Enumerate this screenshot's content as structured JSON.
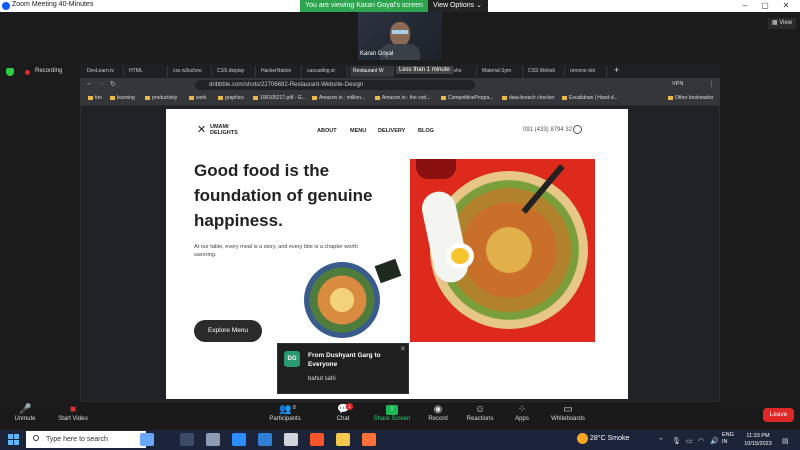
{
  "zoom": {
    "window_title": "Zoom Meeting 40-Minutes",
    "share_banner": "You are viewing Karan Goyal's screen",
    "view_options": "View Options",
    "view_button": "View",
    "recording_label": "Recording",
    "participant_name": "Karan Goyal",
    "overlay_text": "Less than 1 minute",
    "toolbar": {
      "unmute": "Unmute",
      "start_video": "Start Video",
      "participants": "Participants",
      "participants_count": "8",
      "chat": "Chat",
      "chat_badge": "1",
      "share_screen": "Share Screen",
      "record": "Record",
      "reactions": "Reactions",
      "apps": "Apps",
      "whiteboards": "Whiteboards",
      "leave": "Leave"
    },
    "chat_toast": {
      "avatar_initials": "DG",
      "title": "From Dushyant Garg to Everyone",
      "message": "bahut sahi"
    }
  },
  "browser": {
    "tabs": [
      {
        "label": "DevLearn.tv"
      },
      {
        "label": "HTML"
      },
      {
        "label": "css w3schoo"
      },
      {
        "label": "CSS display"
      },
      {
        "label": "HackerNation"
      },
      {
        "label": "cascading st"
      },
      {
        "label": "Restaurant W"
      },
      {
        "label": "in code sho"
      },
      {
        "label": "Material Sym"
      },
      {
        "label": "CSS Websit"
      },
      {
        "label": "remove dot"
      }
    ],
    "url": "dribbble.com/shots/22706692-Restaurant-Website-Design",
    "vpn": "VPN",
    "bookmarks": [
      "fun",
      "learning",
      "productivity",
      "work",
      "graphics",
      "106105217.pdf - G...",
      "Amazon.in : million...",
      "Amazon.in : the cod...",
      "CompetitiveProgra...",
      "data-breach checker",
      "Excalidraw | Hand-d...",
      "Other bookmarks"
    ]
  },
  "site": {
    "logo_line1": "UMAMI",
    "logo_line2": "DELIGHTS",
    "nav": [
      "ABOUT",
      "MENU",
      "DELIVERY",
      "BLOG"
    ],
    "phone": "091 (433) 8794 32",
    "headline": "Good food is the foundation of genuine happiness.",
    "subtext": "At our table, every meal is a story, and every bite is a chapter worth savoring.",
    "cta": "Explore Menu"
  },
  "taskbar": {
    "search_placeholder": "Type here to search",
    "weather": "28°C  Smoke",
    "lang_line1": "ENG",
    "lang_line2": "IN",
    "time": "11:33 PM",
    "date": "10/15/2023"
  },
  "colors": {
    "share_green": "#2da44e",
    "leave_red": "#e02828",
    "photo_red": "#dd2a1d",
    "cta_dark": "#2b2b2b"
  }
}
